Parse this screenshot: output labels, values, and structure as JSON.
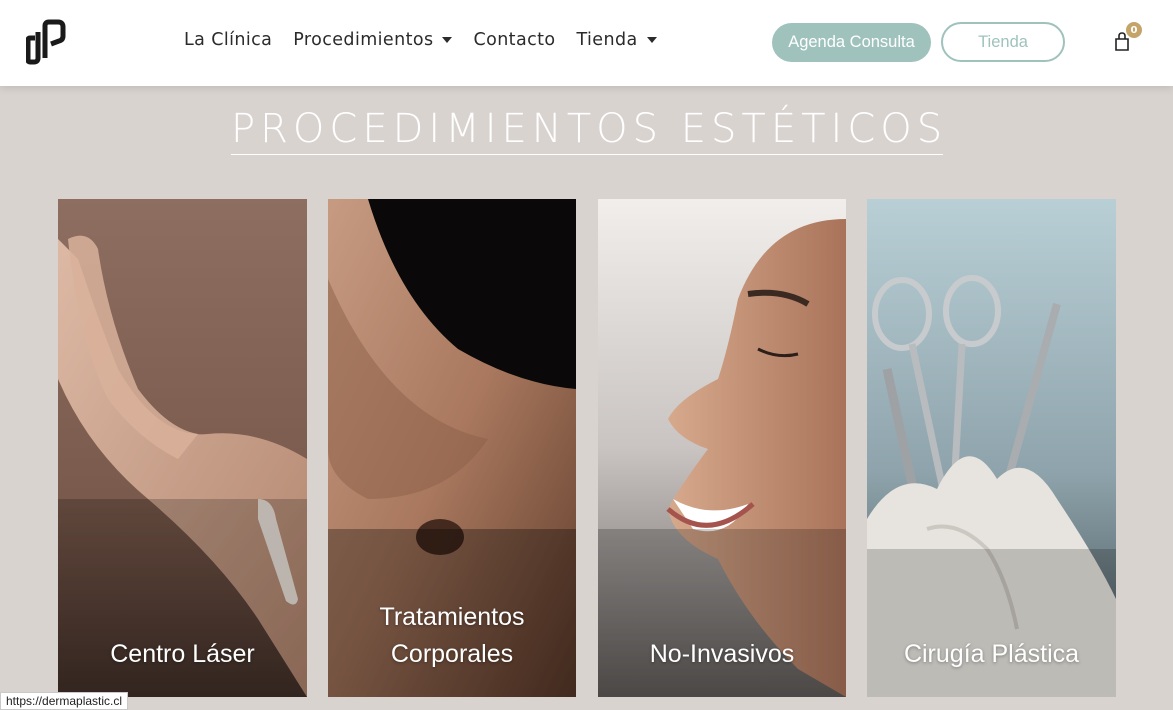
{
  "header": {
    "logo_alt": "dP",
    "nav": [
      {
        "label": "La Clínica",
        "has_dropdown": false
      },
      {
        "label": "Procedimientos",
        "has_dropdown": true
      },
      {
        "label": "Contacto",
        "has_dropdown": false
      },
      {
        "label": "Tienda",
        "has_dropdown": true
      }
    ],
    "cta_primary": "Agenda Consulta",
    "cta_secondary": "Tienda",
    "cart_count": "0"
  },
  "section": {
    "title": "PROCEDIMIENTOS ESTÉTICOS"
  },
  "cards": [
    {
      "label_line1": "Centro Láser",
      "label_line2": ""
    },
    {
      "label_line1": "Tratamientos",
      "label_line2": "Corporales"
    },
    {
      "label_line1": "No-Invasivos",
      "label_line2": ""
    },
    {
      "label_line1": "Cirugía Plástica",
      "label_line2": ""
    }
  ],
  "status_bar": {
    "url": "https://dermaplastic.cl"
  },
  "colors": {
    "accent": "#9fc2bc",
    "background": "#d9d3d0",
    "badge": "#c5a46a"
  },
  "icons": [
    "logo-mark",
    "caret-down-icon",
    "cart-icon"
  ]
}
